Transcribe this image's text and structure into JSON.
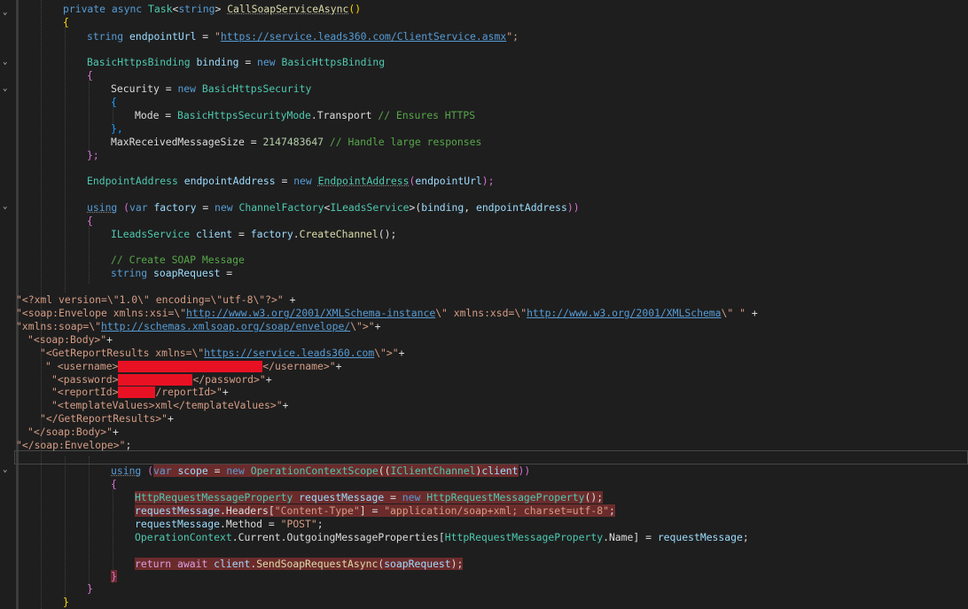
{
  "lines": {
    "l1": {
      "a": "private",
      "b": "async",
      "c": "Task",
      "d": "<",
      "e": "string",
      "f": ">",
      "g": "CallSoapServiceAsync",
      "h": "()"
    },
    "l2": {
      "a": "{"
    },
    "l3": {
      "a": "string",
      "b": "endpointUrl",
      "c": " = ",
      "d": "\"",
      "e": "https://service.leads360.com/ClientService.asmx",
      "f": "\";"
    },
    "l4": {
      "a": "BasicHttpsBinding",
      "b": "binding",
      "c": " = ",
      "d": "new",
      "e": "BasicHttpsBinding"
    },
    "l5": {
      "a": "{"
    },
    "l6": {
      "a": "Security",
      "b": " = ",
      "c": "new",
      "d": "BasicHttpsSecurity"
    },
    "l7": {
      "a": "{"
    },
    "l8": {
      "a": "Mode",
      "b": " = ",
      "c": "BasicHttpsSecurityMode",
      "d": ".",
      "e": "Transport",
      "f": "// Ensures HTTPS"
    },
    "l9": {
      "a": "},"
    },
    "l10": {
      "a": "MaxReceivedMessageSize",
      "b": " = ",
      "c": "2147483647",
      "d": "// Handle large responses"
    },
    "l11": {
      "a": "};"
    },
    "l12": {
      "a": "EndpointAddress",
      "b": "endpointAddress",
      "c": " = ",
      "d": "new",
      "e": "EndpointAddress",
      "f": "(",
      "g": "endpointUrl",
      "h": ");"
    },
    "l13": {
      "a": "using",
      "b": "(",
      "c": "var",
      "d": "factory",
      "e": " = ",
      "f": "new",
      "g": "ChannelFactory",
      "h": "<",
      "i": "ILeadsService",
      "j": ">(",
      "k": "binding",
      "l": ", ",
      "m": "endpointAddress",
      "n": "))"
    },
    "l14": {
      "a": "{"
    },
    "l15": {
      "a": "ILeadsService",
      "b": "client",
      "c": " = ",
      "d": "factory",
      "e": ".",
      "f": "CreateChannel",
      "g": "();"
    },
    "l16": {
      "a": "// Create SOAP Message"
    },
    "l17": {
      "a": "string",
      "b": "soapRequest",
      "c": " ="
    },
    "x1": {
      "a": "\"<?xml version=\\\"1.0\\\" encoding=\\\"utf-8\\\"?>\"",
      "b": " +"
    },
    "x2": {
      "a": "\"<soap:Envelope xmlns:xsi=\\\"",
      "b": "http://www.w3.org/2001/XMLSchema-instance",
      "c": "\\\" xmlns:xsd=\\\"",
      "d": "http://www.w3.org/2001/XMLSchema",
      "e": "\\\" \"",
      "f": " +"
    },
    "x3": {
      "a": "\"xmlns:soap=\\\"",
      "b": "http://schemas.xmlsoap.org/soap/envelope/",
      "c": "\\\">\"",
      "d": "+"
    },
    "x4": {
      "a": "\"<soap:Body>\"",
      "b": "+"
    },
    "x5": {
      "a": "\"<GetReportResults xmlns=\\\"",
      "b": "https://service.leads360.com",
      "c": "\\\">\"",
      "d": "+"
    },
    "x6": {
      "a": "\" <username>",
      "b": "</username>\"",
      "c": "+"
    },
    "x7": {
      "a": "\"<password>",
      "b": "</password>\"",
      "c": "+"
    },
    "x8": {
      "a": "\"<reportId>",
      "b": "/reportId>\"",
      "c": "+"
    },
    "x9": {
      "a": "\"<templateValues>xml</templateValues>\"",
      "b": "+"
    },
    "x10": {
      "a": "\"</GetReportResults>\"",
      "b": "+"
    },
    "x11": {
      "a": "\"</soap:Body>\"",
      "b": "+"
    },
    "x12": {
      "a": "\"</soap:Envelope>\"",
      "b": ";"
    },
    "u1": {
      "a": "using",
      "b": "(",
      "c": "var",
      "d": "scope",
      "e": " = ",
      "f": "new",
      "g": "OperationContextScope",
      "h": "((",
      "i": "IClientChannel",
      "j": ")",
      "k": "client",
      "l": "))"
    },
    "u2": {
      "a": "{"
    },
    "u3": {
      "a": "HttpRequestMessageProperty",
      "b": "requestMessage",
      "c": " = ",
      "d": "new",
      "e": "HttpRequestMessageProperty",
      "f": "();"
    },
    "u4": {
      "a": "requestMessage",
      "b": ".",
      "c": "Headers",
      "d": "[",
      "e": "\"Content-Type\"",
      "f": "] = ",
      "g": "\"application/soap+xml; charset=utf-8\"",
      "h": ";"
    },
    "u5": {
      "a": "requestMessage",
      "b": ".",
      "c": "Method",
      "d": " = ",
      "e": "\"POST\"",
      "f": ";"
    },
    "u6": {
      "a": "OperationContext",
      "b": ".",
      "c": "Current",
      "d": ".",
      "e": "OutgoingMessageProperties",
      "f": "[",
      "g": "HttpRequestMessageProperty",
      "h": ".",
      "i": "Name",
      "j": "] = ",
      "k": "requestMessage",
      "l": ";"
    },
    "u7": {
      "a": "return",
      "b": "await",
      "c": "client",
      "d": ".",
      "e": "SendSoapRequestAsync",
      "f": "(",
      "g": "soapRequest",
      "h": ");"
    },
    "u8": {
      "a": "}"
    },
    "u9": {
      "a": "}"
    },
    "u10": {
      "a": "}"
    }
  },
  "fold_icon": "chevron-down-icon",
  "colors": {
    "background": "#1e1e1e",
    "keyword": "#569cd6",
    "type": "#4ec9b0",
    "string": "#d69d85",
    "comment": "#57a64a",
    "highlight": "#6b2b2b",
    "redaction": "#e81123"
  }
}
